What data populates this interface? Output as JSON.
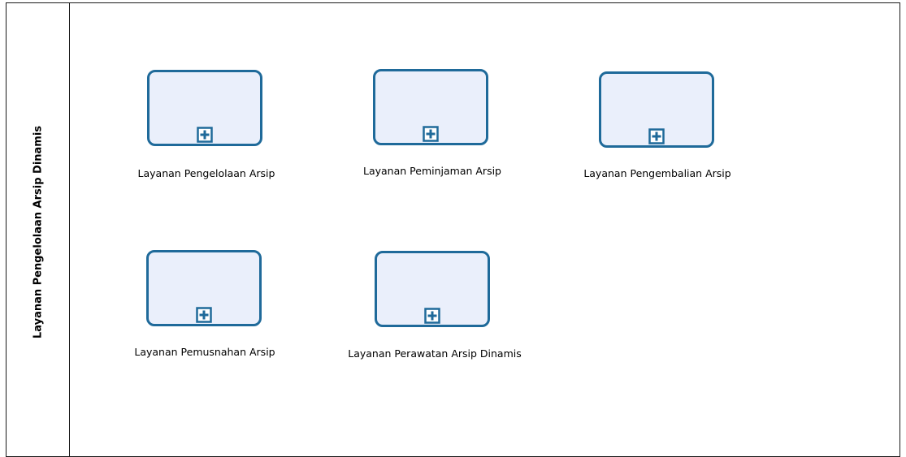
{
  "pool": {
    "label": "Layanan Pengelolaan Arsip Dinamis"
  },
  "tasks": [
    {
      "label": "Layanan Pengelolaan Arsip"
    },
    {
      "label": "Layanan Peminjaman Arsip"
    },
    {
      "label": "Layanan Pengembalian Arsip"
    },
    {
      "label": "Layanan Pemusnahan Arsip"
    },
    {
      "label": "Layanan Perawatan Arsip Dinamis"
    }
  ],
  "colors": {
    "task_border": "#1f6a9a",
    "task_fill": "#eaeffb",
    "pool_border": "#1a1a1a"
  },
  "icons": {
    "subprocess_marker": "plus-square-icon"
  }
}
